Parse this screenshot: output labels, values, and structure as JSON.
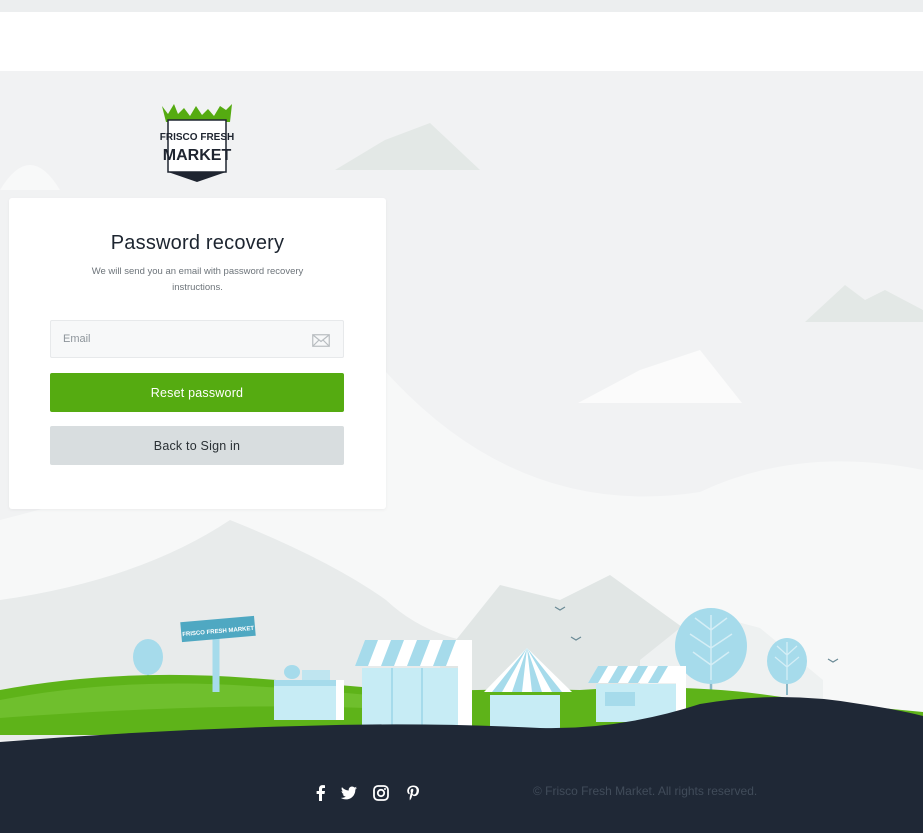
{
  "brand": {
    "logo_line1": "FRISCO FRESH",
    "logo_line2": "MARKET",
    "sign_text": "FRISCO FRESH MARKET"
  },
  "recovery": {
    "title": "Password recovery",
    "subtitle": "We will send you an email with password recovery instructions.",
    "email_placeholder": "Email",
    "email_value": "",
    "reset_label": "Reset password",
    "back_label": "Back to Sign in"
  },
  "footer": {
    "social_icons": [
      "facebook-icon",
      "twitter-icon",
      "instagram-icon",
      "pinterest-icon"
    ],
    "copyright": "© Frisco Fresh Market. All rights reserved."
  },
  "colors": {
    "accent_green": "#55ab11",
    "footer_navy": "#1f2836",
    "awning_blue": "#a6dbeb",
    "page_background": "#f1f2f3"
  }
}
